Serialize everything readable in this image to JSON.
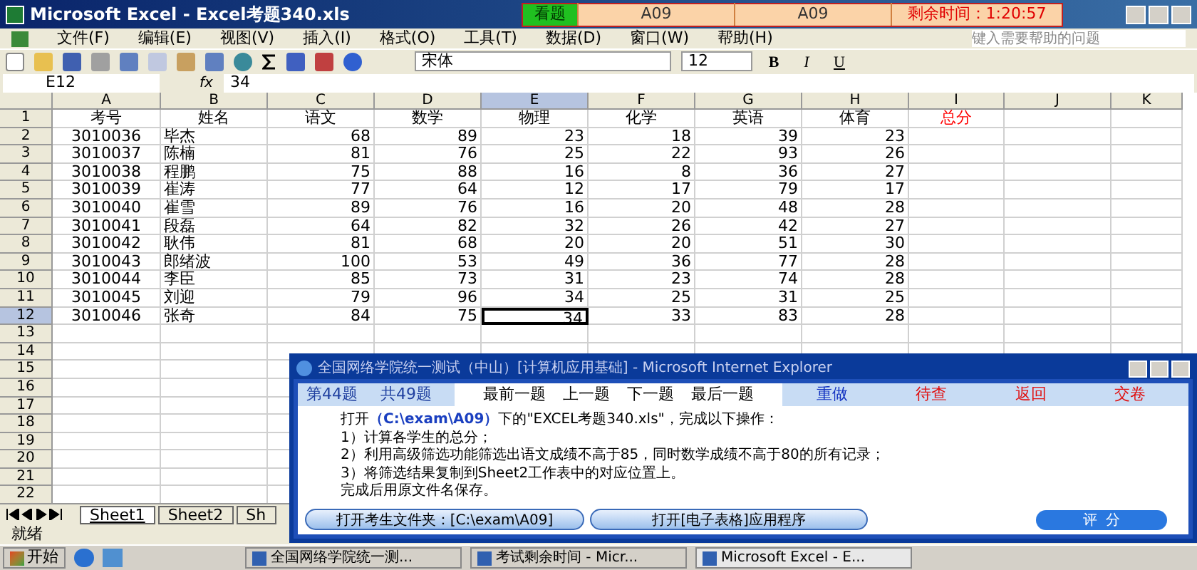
{
  "window": {
    "title": "Microsoft Excel - Excel考题340.xls"
  },
  "exam_bar": {
    "status": "看题",
    "fields": [
      "A09",
      "A09"
    ],
    "timer": "剩余时间：1:20:57"
  },
  "menu": [
    "文件(F)",
    "编辑(E)",
    "视图(V)",
    "插入(I)",
    "格式(O)",
    "工具(T)",
    "数据(D)",
    "窗口(W)",
    "帮助(H)"
  ],
  "help_placeholder": "键入需要帮助的问题",
  "toolbar": {
    "font": "宋体",
    "size": "12",
    "format_buttons": [
      "B",
      "I",
      "U"
    ]
  },
  "formula_bar": {
    "name_box": "E12",
    "fx": "fx",
    "value": "34"
  },
  "sheet": {
    "columns": [
      {
        "label": "A",
        "selected": false
      },
      {
        "label": "B",
        "selected": false
      },
      {
        "label": "C",
        "selected": false
      },
      {
        "label": "D",
        "selected": false
      },
      {
        "label": "E",
        "selected": true
      },
      {
        "label": "F",
        "selected": false
      },
      {
        "label": "G",
        "selected": false
      },
      {
        "label": "H",
        "selected": false
      },
      {
        "label": "I",
        "selected": false
      },
      {
        "label": "J",
        "selected": false
      },
      {
        "label": "K",
        "selected": false
      }
    ],
    "header_row": {
      "num": "1",
      "cells": [
        {
          "text": "考号",
          "color": "#000000"
        },
        {
          "text": "姓名",
          "color": "#000000"
        },
        {
          "text": "语文",
          "color": "#000000"
        },
        {
          "text": "数学",
          "color": "#000000"
        },
        {
          "text": "物理",
          "color": "#000000"
        },
        {
          "text": "化学",
          "color": "#000000"
        },
        {
          "text": "英语",
          "color": "#000000"
        },
        {
          "text": "体育",
          "color": "#000000"
        },
        {
          "text": "总分",
          "color": "#ff0000"
        }
      ]
    },
    "rows": [
      {
        "num": "2",
        "selected": false,
        "cells": [
          "3010036",
          "毕杰",
          "68",
          "89",
          "23",
          "18",
          "39",
          "23"
        ]
      },
      {
        "num": "3",
        "selected": false,
        "cells": [
          "3010037",
          "陈楠",
          "81",
          "76",
          "25",
          "22",
          "93",
          "26"
        ]
      },
      {
        "num": "4",
        "selected": false,
        "cells": [
          "3010038",
          "程鹏",
          "75",
          "88",
          "16",
          "8",
          "36",
          "27"
        ]
      },
      {
        "num": "5",
        "selected": false,
        "cells": [
          "3010039",
          "崔涛",
          "77",
          "64",
          "12",
          "17",
          "79",
          "17"
        ]
      },
      {
        "num": "6",
        "selected": false,
        "cells": [
          "3010040",
          "崔雪",
          "89",
          "76",
          "16",
          "20",
          "48",
          "28"
        ]
      },
      {
        "num": "7",
        "selected": false,
        "cells": [
          "3010041",
          "段磊",
          "64",
          "82",
          "32",
          "26",
          "42",
          "27"
        ]
      },
      {
        "num": "8",
        "selected": false,
        "cells": [
          "3010042",
          "耿伟",
          "81",
          "68",
          "20",
          "20",
          "51",
          "30"
        ]
      },
      {
        "num": "9",
        "selected": false,
        "cells": [
          "3010043",
          "郎绪波",
          "100",
          "53",
          "49",
          "36",
          "77",
          "28"
        ]
      },
      {
        "num": "10",
        "selected": false,
        "cells": [
          "3010044",
          "李臣",
          "85",
          "73",
          "31",
          "23",
          "74",
          "28"
        ]
      },
      {
        "num": "11",
        "selected": false,
        "cells": [
          "3010045",
          "刘迎",
          "79",
          "96",
          "34",
          "25",
          "31",
          "25"
        ]
      },
      {
        "num": "12",
        "selected": true,
        "cells": [
          "3010046",
          "张奇",
          "84",
          "75",
          "34",
          "33",
          "83",
          "28"
        ]
      }
    ],
    "empty_rows": [
      "13",
      "14",
      "15",
      "16",
      "17",
      "18",
      "19",
      "20",
      "21",
      "22"
    ],
    "tabs": [
      {
        "label": "Sheet1",
        "selected": true
      },
      {
        "label": "Sheet2",
        "selected": false
      },
      {
        "label": "Sh",
        "selected": false
      }
    ]
  },
  "status_bar": "就绪",
  "dialog": {
    "title": "全国网络学院统一测试（中山）[计算机应用基础] - Microsoft Internet Explorer",
    "counter": [
      "第44题",
      "共49题"
    ],
    "nav": [
      "最前一题",
      "上一题",
      "下一题",
      "最后一题"
    ],
    "actions": [
      {
        "label": "重做",
        "color": "#1030c0"
      },
      {
        "label": "待查",
        "color": "#e01010"
      },
      {
        "label": "返回",
        "color": "#e01010"
      },
      {
        "label": "交卷",
        "color": "#e01010"
      }
    ],
    "lines": [
      "打开**（C:\\exam\\A09）**下的\"EXCEL考题340.xls\"，完成以下操作：",
      "1）计算各学生的总分；",
      "2）利用高级筛选功能筛选出语文成绩不高于85，同时数学成绩不高于80的所有记录；",
      "3）将筛选结果复制到Sheet2工作表中的对应位置上。",
      "完成后用原文件名保存。"
    ],
    "buttons": [
      "打开考生文件夹：[C:\\exam\\A09]",
      "打开[电子表格]应用程序"
    ],
    "score_button": "评  分"
  },
  "taskbar": {
    "start": "开始",
    "items": [
      "全国网络学院统一测...",
      "考试剩余时间 - Micr...",
      "Microsoft Excel - E..."
    ]
  }
}
